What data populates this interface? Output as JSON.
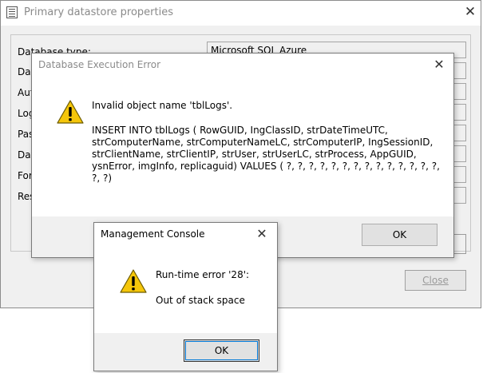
{
  "primary": {
    "title": "Primary datastore properties",
    "fields": [
      {
        "label": "Database type:",
        "value": "Microsoft SQL Azure"
      },
      {
        "label": "Data",
        "value": ""
      },
      {
        "label": "Auth",
        "value": ""
      },
      {
        "label": "Login",
        "value": ""
      },
      {
        "label": "Pass",
        "value": ""
      },
      {
        "label": "Data",
        "value": ""
      },
      {
        "label": "Forc",
        "value": ""
      },
      {
        "label": "Resp",
        "value": ""
      }
    ],
    "close_label": "Close"
  },
  "error_dialog": {
    "title": "Database Execution Error",
    "icon": "warning-icon",
    "message": "Invalid object name 'tblLogs'.",
    "sql": "INSERT INTO tblLogs ( RowGUID, IngClassID, strDateTimeUTC, strComputerName, strComputerNameLC, strComputerIP, IngSessionID, strClientName, strClientIP, strUser, strUserLC, strProcess, AppGUID, ysnError, imgInfo, replicaguid) VALUES ( ?, ?, ?, ?, ?, ?, ?, ?, ?, ?, ?, ?, ?, ?, ?, ?)",
    "ok_label": "OK"
  },
  "mc_dialog": {
    "title": "Management Console",
    "icon": "warning-icon",
    "line1": "Run-time error '28':",
    "line2": "Out of stack space",
    "ok_label": "OK"
  },
  "colors": {
    "warning_yellow": "#f5c60a",
    "focus_blue": "#0078d7"
  }
}
